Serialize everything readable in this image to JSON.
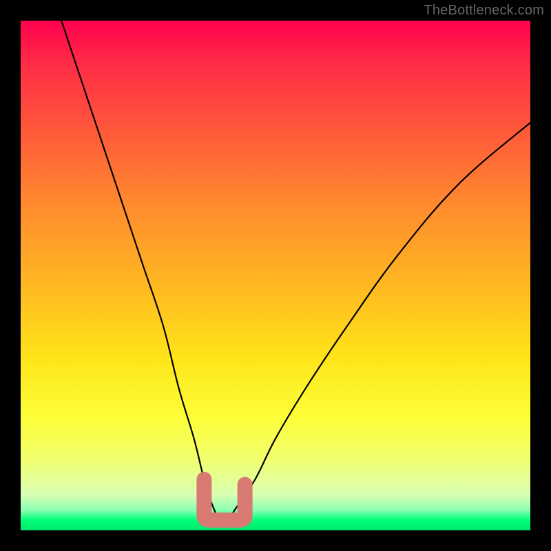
{
  "watermark": "TheBottleneck.com",
  "chart_data": {
    "type": "line",
    "title": "",
    "xlabel": "",
    "ylabel": "",
    "xlim": [
      0,
      100
    ],
    "ylim": [
      0,
      100
    ],
    "background_gradient": {
      "top_color": "#ff004e",
      "mid_colors": [
        "#ff8a2e",
        "#ffe419"
      ],
      "bottom_color": "#00ff77",
      "meaning": "bottleneck severity (red=high, green=low)"
    },
    "series": [
      {
        "name": "bottleneck-curve",
        "x": [
          8,
          12,
          16,
          20,
          24,
          28,
          31,
          34,
          36,
          38,
          40,
          42,
          46,
          50,
          56,
          64,
          74,
          86,
          100
        ],
        "values": [
          100,
          88,
          76,
          64,
          52,
          40,
          28,
          18,
          10,
          4,
          1,
          4,
          10,
          18,
          28,
          40,
          54,
          68,
          80
        ]
      }
    ],
    "marker": {
      "name": "optimal-region",
      "x_range": [
        36,
        44
      ],
      "y": 2,
      "color": "#d87a72",
      "description": "near-zero bottleneck zone"
    },
    "grid": false,
    "legend": false
  }
}
